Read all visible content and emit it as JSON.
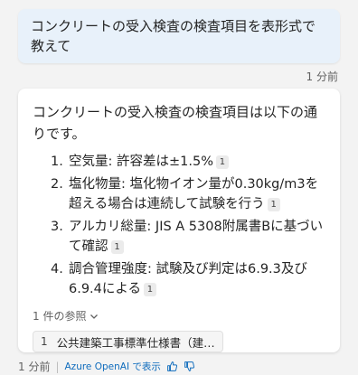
{
  "user_message": {
    "text": "コンクリートの受入検査の検査項目を表形式で教えて",
    "time": "1 分前"
  },
  "bot_message": {
    "intro": "コンクリートの受入検査の検査項目は以下の通りです。",
    "items": [
      {
        "num": "1.",
        "text": "空気量: 許容差は±1.5%",
        "cite": "1"
      },
      {
        "num": "2.",
        "text": "塩化物量: 塩化物イオン量が0.30kg/m3を超える場合は連続して試験を行う",
        "cite": "1"
      },
      {
        "num": "3.",
        "text": "アルカリ総量: JIS A 5308附属書Bに基づいて確認",
        "cite": "1"
      },
      {
        "num": "4.",
        "text": "調合管理強度: 試験及び判定は6.9.3及び6.9.4による",
        "cite": "1"
      }
    ],
    "references_toggle": "1 件の参照",
    "reference": {
      "num": "1",
      "title": "公共建築工事標準仕様書（建…"
    }
  },
  "footer": {
    "time": "1 分前",
    "separator": "|",
    "ai_label": "Azure OpenAI で表示",
    "icons": [
      "thumbs-up-icon",
      "thumbs-down-icon"
    ],
    "accent": "#0f6cbd"
  }
}
